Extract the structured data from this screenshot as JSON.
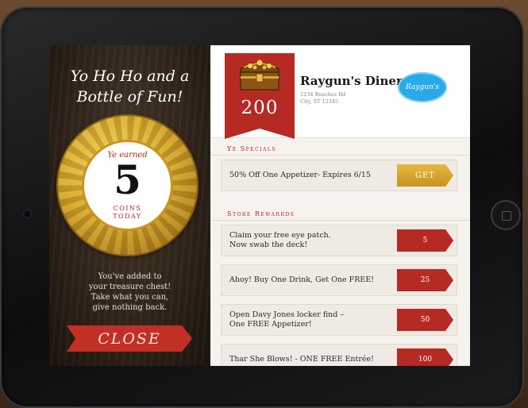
{
  "left_panel": {
    "tagline_line1": "Yo Ho Ho and a",
    "tagline_line2": "Bottle of Fun!",
    "coin": {
      "earned_label": "Ye earned",
      "number": "5",
      "label_line1": "COINS",
      "label_line2": "TODAY"
    },
    "message_line1": "You've added to",
    "message_line2": "your treasure chest!",
    "message_line3": "Take what you can,",
    "message_line4": "give nothing back.",
    "close_label": "CLOSE"
  },
  "header": {
    "points": "200",
    "business_name": "Raygun's Diner",
    "address_line1": "1234 Beeches Rd",
    "address_line2": "City, ST 12345",
    "logo_text": "Raygun's"
  },
  "specials": {
    "title": "Ye Specials",
    "items": [
      {
        "text": "50% Off One Appetizer- Expires 6/15",
        "action": "GET"
      }
    ]
  },
  "rewards": {
    "title": "Store Rewarrds",
    "items": [
      {
        "line1": "Claim your free eye patch.",
        "line2": "Now swab the deck!",
        "cost": "5"
      },
      {
        "line1": "Ahoy! Buy One Drink, Get One FREE!",
        "line2": "",
        "cost": "25"
      },
      {
        "line1": "Open Davy Jones locker find –",
        "line2": "One FREE Appetizer!",
        "cost": "50"
      },
      {
        "line1": "Thar She Blows! - ONE FREE Entrée!",
        "line2": "",
        "cost": "100"
      }
    ]
  },
  "colors": {
    "accent_red": "#b52a23",
    "gold": "#d4a62b",
    "logo_blue": "#29a9e8"
  }
}
